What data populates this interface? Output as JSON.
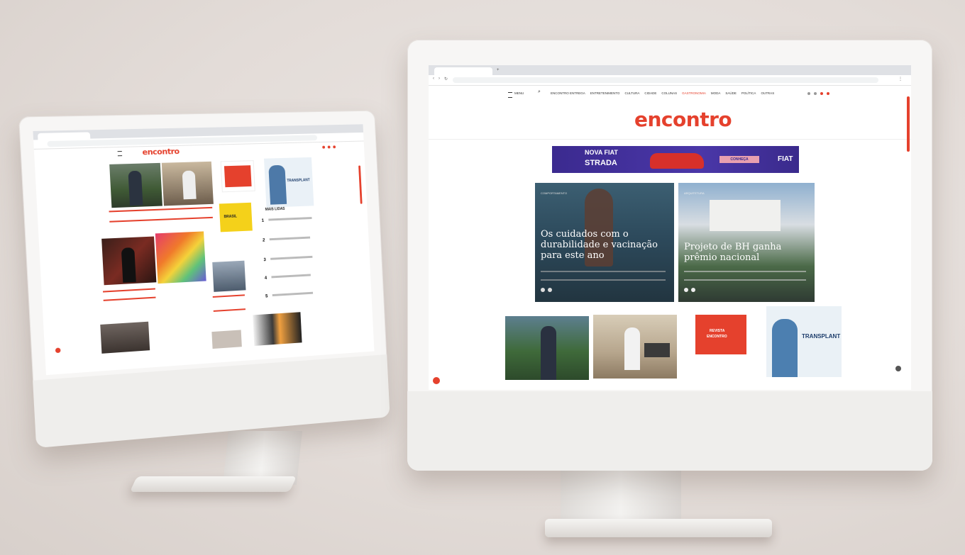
{
  "site": {
    "logo": "encontro",
    "brand_color": "#e5412d"
  },
  "right_monitor": {
    "nav": {
      "menu_label": "MENU",
      "items": [
        "ENCONTRO ENTREGA",
        "ENTRETENIMENTO",
        "CULTURA",
        "CIDADE",
        "COLUNAS",
        "GASTRONOMIA",
        "MODA",
        "SAÚDE",
        "POLÍTICA",
        "OUTRAS"
      ],
      "highlight_index": 5
    },
    "top_ad": {
      "line1": "NOVA FIAT",
      "line2": "STRADA",
      "button": "CONHEÇA",
      "brand": "FIAT"
    },
    "hero": [
      {
        "kicker": "COMPORTAMENTO",
        "title": "Os cuidados com o durabilidade e vacinação para este ano"
      },
      {
        "kicker": "ARQUITETURA",
        "title": "Projeto de BH ganha prêmio nacional"
      }
    ],
    "ads": {
      "revista": [
        "REVISTA",
        "ENCONTRO"
      ],
      "transplant": "TRANSPLANT"
    }
  },
  "left_monitor": {
    "ad_transplant": "TRANSPLANT",
    "ad_yellow": "BRASIL",
    "sidebar_heading": "MAIS LIDAS",
    "rank": [
      "1",
      "2",
      "3",
      "4",
      "5"
    ]
  }
}
